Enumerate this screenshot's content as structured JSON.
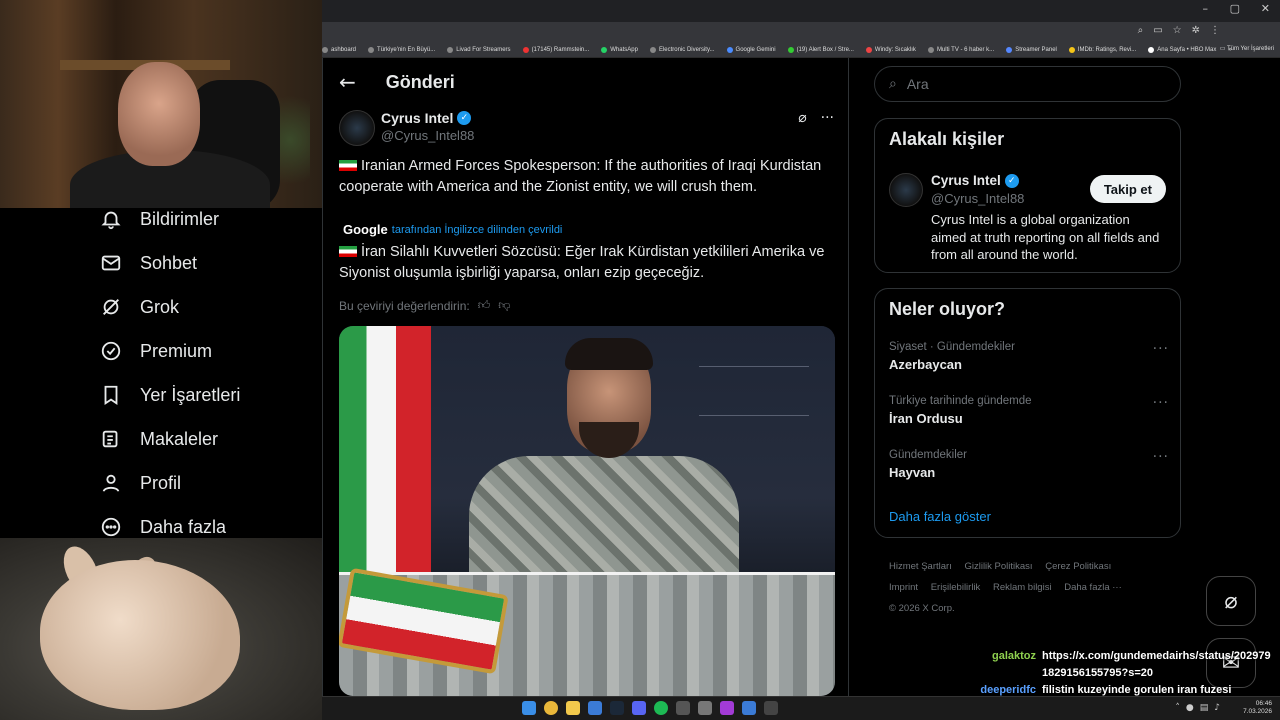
{
  "browser": {
    "window_controls": [
      "–",
      "▢",
      "✕"
    ],
    "bookmarks": [
      "ashboard",
      "Türkiye'nin En Büyü...",
      "Livad For Streamers",
      "(17145) Rammstein...",
      "WhatsApp",
      "Electronic Diversity...",
      "Google Gemini",
      "(19) Alert Box / Stre...",
      "Windy: Sıcaklık",
      "Multi TV - 6 haber k...",
      "Streamer Panel",
      "IMDb: Ratings, Revi...",
      "Ana Sayfa • HBO Max"
    ],
    "bookmarks_more": "»",
    "all_bookmarks": "Tüm Yer İşaretleri"
  },
  "nav": {
    "items": [
      {
        "label": "Bildirimler",
        "icon": "bell-icon"
      },
      {
        "label": "Sohbet",
        "icon": "mail-icon"
      },
      {
        "label": "Grok",
        "icon": "grok-icon"
      },
      {
        "label": "Premium",
        "icon": "verified-badge-icon"
      },
      {
        "label": "Yer İşaretleri",
        "icon": "bookmark-icon"
      },
      {
        "label": "Makaleler",
        "icon": "article-icon"
      },
      {
        "label": "Profil",
        "icon": "person-icon"
      },
      {
        "label": "Daha fazla",
        "icon": "more-circle-icon"
      }
    ]
  },
  "post": {
    "header_title": "Gönderi",
    "author_name": "Cyrus Intel",
    "author_handle": "@Cyrus_Intel88",
    "text_en": "Iranian Armed Forces Spokesperson: If the authorities of Iraqi Kurdistan cooperate with America and the Zionist entity, we will crush them.",
    "google_label": "Google",
    "translated_label": "tarafından İngilizce dilinden çevrildi",
    "text_tr": "İran Silahlı Kuvvetleri Sözcüsü: Eğer Irak Kürdistan yetkilileri Amerika ve Siyonist oluşumla işbirliği yaparsa, onları ezip geçeceğiz.",
    "rate_label": "Bu çeviriyi değerlendirin:"
  },
  "sidebar": {
    "search_placeholder": "Ara",
    "related_title": "Alakalı kişiler",
    "related": {
      "name": "Cyrus Intel",
      "handle": "@Cyrus_Intel88",
      "follow_label": "Takip et",
      "bio": "Cyrus Intel is a global organization aimed at truth reporting on all fields and from all around the world."
    },
    "trends_title": "Neler oluyor?",
    "trends": [
      {
        "meta": "Siyaset · Gündemdekiler",
        "name": "Azerbaycan"
      },
      {
        "meta": "Türkiye tarihinde gündemde",
        "name": "İran Ordusu"
      },
      {
        "meta": "Gündemdekiler",
        "name": "Hayvan"
      }
    ],
    "show_more": "Daha fazla göster",
    "footer": [
      "Hizmet Şartları",
      "Gizlilik Politikası",
      "Çerez Politikası",
      "Imprint",
      "Erişilebilirlik",
      "Reklam bilgisi",
      "Daha fazla ···",
      "© 2026 X Corp."
    ]
  },
  "chat": [
    {
      "user": "galaktoz",
      "message": "https://x.com/gundemedairhs/status/2029791829156155795?s=20"
    },
    {
      "user": "deeperidfc",
      "message": "filistin kuzeyinde gorulen iran fuzesi onlendigini de soylemistim"
    }
  ],
  "taskbar": {
    "clock_time": "06:46",
    "clock_date": "7.03.2026"
  },
  "colors": {
    "accent": "#1d9bf0",
    "background": "#000000",
    "border": "#2f3336",
    "muted_text": "#71767b"
  }
}
